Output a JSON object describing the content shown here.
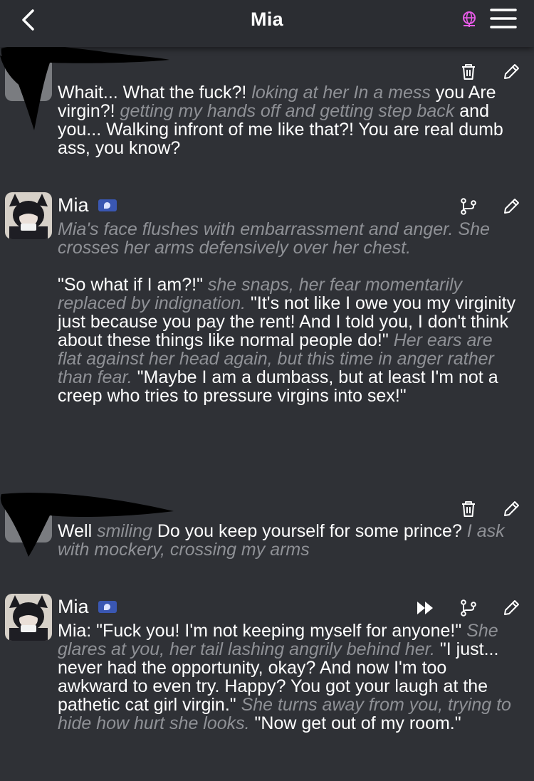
{
  "header": {
    "title": "Mia",
    "back_icon": "chevron-left-icon",
    "globe_icon": "globe-icon",
    "menu_icon": "hamburger-menu-icon",
    "globe_color": "#e85be8"
  },
  "messages": [
    {
      "sender": "",
      "name_redacted": true,
      "actions": [
        "trash-icon",
        "pencil-icon"
      ],
      "segments": [
        {
          "type": "speech",
          "text": "Whait... What the fuck?! "
        },
        {
          "type": "action",
          "text": "loking at her In a mess"
        },
        {
          "type": "speech",
          "text": " you Are virgin?! "
        },
        {
          "type": "action",
          "text": "getting my hands off and getting step back"
        },
        {
          "type": "speech",
          "text": " and you... Walking infront of me like that?! You are real dumb ass, you know?"
        }
      ]
    },
    {
      "sender": "Mia",
      "actions": [
        "branch-icon",
        "pencil-icon"
      ],
      "segments": [
        {
          "type": "action",
          "text": "Mia's face flushes with embarrassment and anger. She crosses her arms defensively over her chest."
        },
        {
          "type": "speech",
          "text": "\n\n\"So what if I am?!\" "
        },
        {
          "type": "action",
          "text": "she snaps, her fear momentarily replaced by indignation."
        },
        {
          "type": "speech",
          "text": " \"It's not like I owe you my virginity just because you pay the rent! And I told you, I don't think about these things like normal people do!\" "
        },
        {
          "type": "action",
          "text": "Her ears are flat against her head again, but this time in anger rather than fear."
        },
        {
          "type": "speech",
          "text": " \"Maybe I am a dumbass, but at least I'm not a creep who tries to pressure virgins into sex!\""
        }
      ]
    },
    {
      "sender": "",
      "name_redacted": true,
      "actions": [
        "trash-icon",
        "pencil-icon"
      ],
      "segments": [
        {
          "type": "speech",
          "text": "Well "
        },
        {
          "type": "action",
          "text": "smiling"
        },
        {
          "type": "speech",
          "text": " Do you keep yourself for some prince? "
        },
        {
          "type": "action",
          "text": "I ask with mockery, crossing my arms"
        }
      ]
    },
    {
      "sender": "Mia",
      "actions": [
        "fast-forward-icon",
        "branch-icon",
        "pencil-icon"
      ],
      "segments": [
        {
          "type": "speech",
          "text": "Mia: \"Fuck you! I'm not keeping myself for anyone!\" "
        },
        {
          "type": "action",
          "text": "She glares at you, her tail lashing angrily behind her."
        },
        {
          "type": "speech",
          "text": " \"I just... never had the opportunity, okay? And now I'm too awkward to even try. Happy? You got your laugh at the pathetic cat girl virgin.\" "
        },
        {
          "type": "action",
          "text": "She turns away from you, trying to hide how hurt she looks."
        },
        {
          "type": "speech",
          "text": " \"Now get out of my room.\""
        }
      ]
    }
  ]
}
